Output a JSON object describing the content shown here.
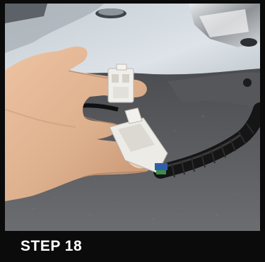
{
  "caption": {
    "step_label": "STEP 18"
  },
  "photo": {
    "colors": {
      "background_panel": "#cfd6dc",
      "carpet": "#5a5c60",
      "skin": "#e2b28f",
      "connector": "#eceae6",
      "harness_sleeve": "#151515",
      "frame": "#0b0b0b"
    }
  }
}
